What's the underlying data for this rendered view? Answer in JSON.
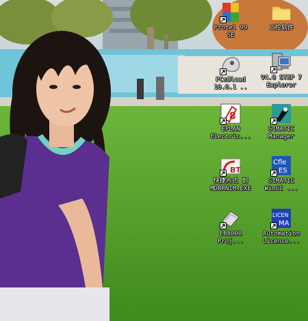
{
  "desktop": {
    "icons": [
      {
        "id": "protel",
        "line1": "Protel 99",
        "line2": "SE",
        "shortcut": true
      },
      {
        "id": "gongkong",
        "line1": "工控软件",
        "line2": "",
        "shortcut": false
      },
      {
        "id": "pcsbcad",
        "line1": "PCsBlcad",
        "line2": "10.0.1 ..",
        "shortcut": true
      },
      {
        "id": "v40step",
        "line1": "V4.0 STEP 7",
        "line2": "Explorer",
        "shortcut": true
      },
      {
        "id": "eplan",
        "line1": "EPLAN",
        "line2": "Electric...",
        "shortcut": true
      },
      {
        "id": "simatic-mgr",
        "line1": "SIMATIC",
        "line2": "Manager",
        "shortcut": true
      },
      {
        "id": "kuaijie",
        "line1": "快捷方式 到",
        "line2": "MDBRNIM.EXE",
        "shortcut": true
      },
      {
        "id": "wincc",
        "line1": "SIMATIC",
        "line2": "WinCC ...",
        "shortcut": true
      },
      {
        "id": "eb8000",
        "line1": "EB8000",
        "line2": "Proj...",
        "shortcut": true
      },
      {
        "id": "automation-license",
        "line1": "Automation",
        "line2": "License...",
        "shortcut": true
      }
    ]
  },
  "colors": {
    "grass": "#4f9a2a",
    "sky": "#e9eef2",
    "shirt": "#5a2f8f"
  }
}
